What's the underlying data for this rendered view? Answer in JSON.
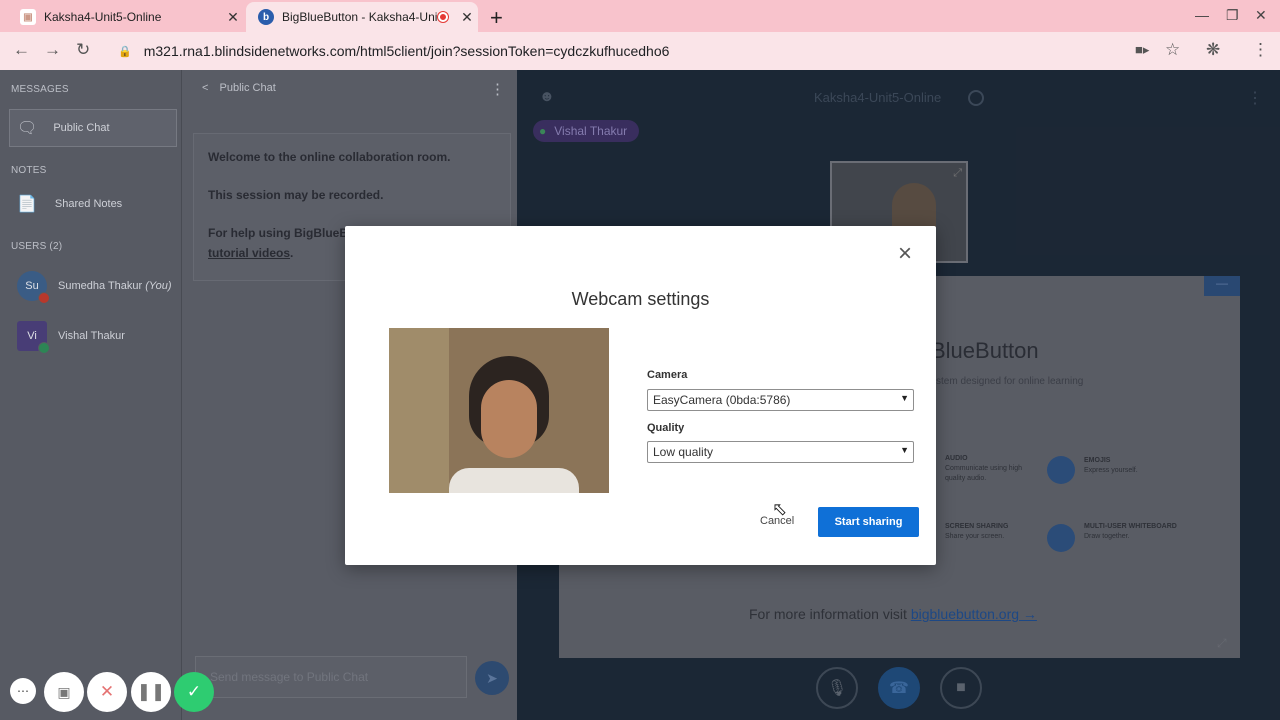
{
  "browser": {
    "tabs": [
      {
        "title": "Kaksha4-Unit5-Online",
        "close": "✕"
      },
      {
        "title": "BigBlueButton - Kaksha4-Uni",
        "close": "✕"
      }
    ],
    "new_tab": "+",
    "url": "m321.rna1.blindsidenetworks.com/html5client/join?sessionToken=cydczkufhucedho6",
    "window_controls": {
      "minimize": "—",
      "restore": "❐",
      "close": "✕"
    }
  },
  "sidebar": {
    "messages_heading": "MESSAGES",
    "public_chat": "Public Chat",
    "notes_heading": "NOTES",
    "shared_notes": "Shared Notes",
    "users_heading": "USERS (2)",
    "users": [
      {
        "initials": "Su",
        "name": "Sumedha Thakur",
        "you": "(You)"
      },
      {
        "initials": "Vi",
        "name": "Vishal Thakur"
      }
    ]
  },
  "chat": {
    "title": "Public Chat",
    "back": "<",
    "welcome_line1": "Welcome to the online collaboration room.",
    "welcome_line2": "This session may be recorded.",
    "welcome_line3": "For help using BigBlueB",
    "tutorial_link": "tutorial videos",
    "tutorial_after": ".",
    "input_placeholder": "Send message to Public Chat"
  },
  "main": {
    "meeting_title": "Kaksha4-Unit5-Online",
    "talking_indicator": "Vishal Thakur",
    "slide": {
      "title": "BlueButton",
      "subtitle": "ystem designed for online learning",
      "features": [
        {
          "title": "AUDIO",
          "desc": "Communicate using high quality audio."
        },
        {
          "title": "EMOJIS",
          "desc": "Express yourself."
        },
        {
          "title": "SCREEN SHARING",
          "desc": "Share your screen."
        },
        {
          "title": "MULTI-USER WHITEBOARD",
          "desc": "Draw together."
        }
      ],
      "more_info": "For more information visit",
      "more_link": "bigbluebutton.org →"
    }
  },
  "modal": {
    "title": "Webcam settings",
    "close": "×",
    "camera_label": "Camera",
    "camera_value": "EasyCamera (0bda:5786)",
    "quality_label": "Quality",
    "quality_value": "Low quality",
    "cancel": "Cancel",
    "start": "Start sharing"
  },
  "colors": {
    "primary": "#0f70d7",
    "tab_bar": "#f8c3cc",
    "address_bar": "#fae4e8",
    "fab_green": "#2ecc71"
  }
}
